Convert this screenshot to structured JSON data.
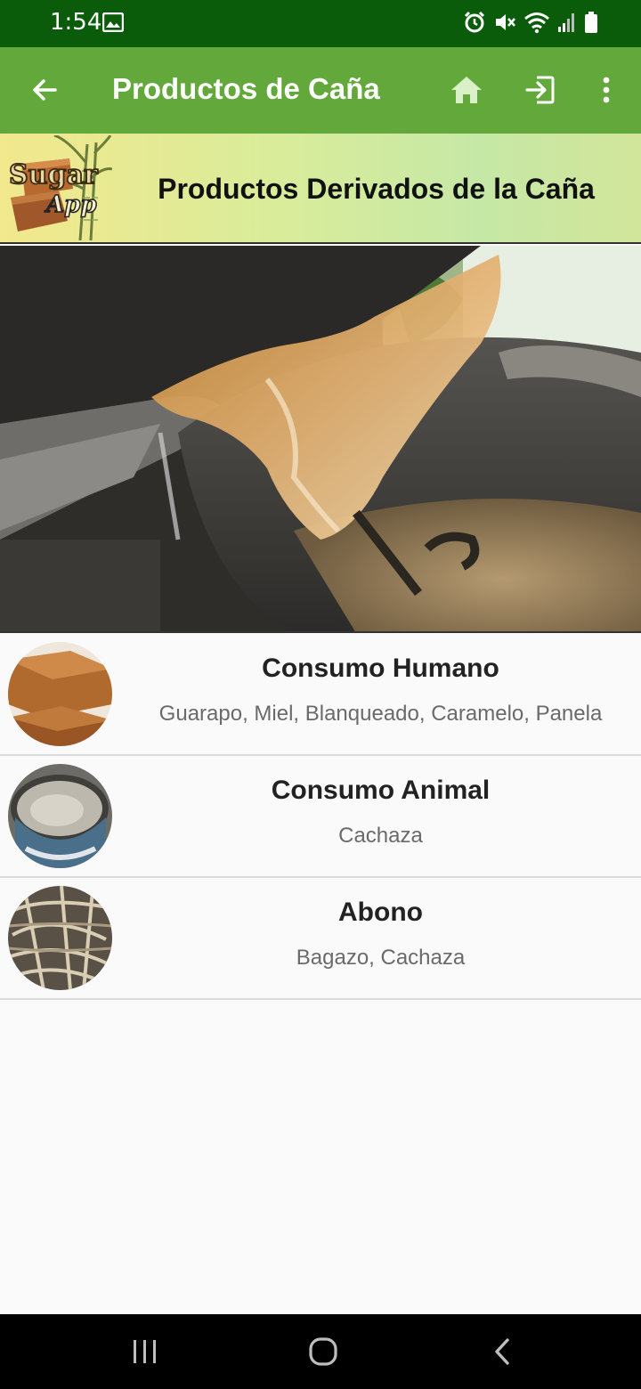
{
  "status_bar": {
    "time": "1:54",
    "icons": [
      "image-icon",
      "alarm-icon",
      "mute-icon",
      "wifi-icon",
      "signal-icon",
      "battery-icon"
    ]
  },
  "app_bar": {
    "title": "Productos de Caña",
    "actions": [
      "back-arrow-icon",
      "home-icon",
      "exit-icon",
      "more-vert-icon"
    ],
    "color": "#63a83a"
  },
  "banner": {
    "logo_text_line1": "Sugar",
    "logo_text_line2": "App",
    "title": "Productos Derivados de la Caña"
  },
  "list": {
    "items": [
      {
        "title": "Consumo Humano",
        "subtitle": "Guarapo, Miel, Blanqueado, Caramelo, Panela"
      },
      {
        "title": "Consumo Animal",
        "subtitle": "Cachaza"
      },
      {
        "title": "Abono",
        "subtitle": "Bagazo, Cachaza"
      }
    ]
  },
  "colors": {
    "status_bar": "#0a5c0a",
    "app_bar": "#63a83a",
    "background": "#fafafa"
  }
}
